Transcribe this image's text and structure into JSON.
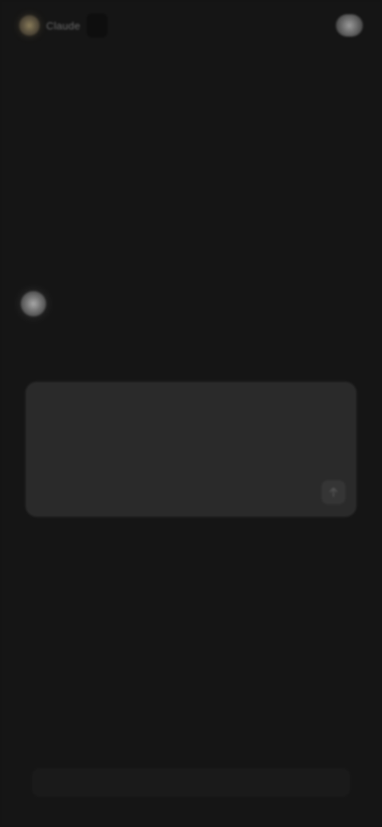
{
  "header": {
    "brand_text": "Claude",
    "model_label": "",
    "top_link": "",
    "avatar_icon": "user-avatar-icon"
  },
  "greeting": {
    "icon": "logo-spark-icon",
    "title": ""
  },
  "composer": {
    "placeholder": "",
    "send_icon": "arrow-up-icon"
  },
  "footer": {
    "note": ""
  },
  "colors": {
    "background": "#151515",
    "composer_bg": "#2a2a2a",
    "accent": "#8a7d5a"
  }
}
